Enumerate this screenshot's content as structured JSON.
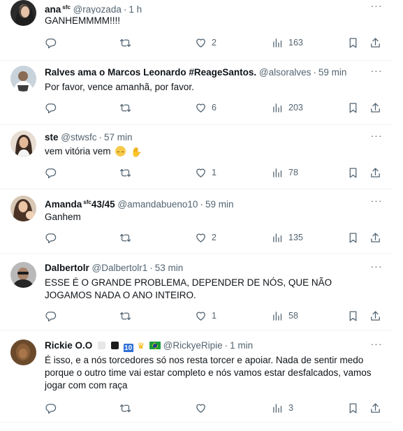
{
  "tweets": [
    {
      "name": "ana",
      "name_badge": "sfc",
      "handle": "@rayozada",
      "time": "1 h",
      "text": "GANHEMMMM!!!!",
      "replies": "",
      "retweets": "",
      "likes": "2",
      "views": "163"
    },
    {
      "name": "Ralves ama o Marcos Leonardo #ReageSantos.",
      "handle": "@alsoralves",
      "time": "59 min",
      "text": "Por favor, vence amanhã, por favor.",
      "replies": "",
      "retweets": "",
      "likes": "6",
      "views": "203"
    },
    {
      "name": "ste",
      "handle": "@stwsfc",
      "time": "57 min",
      "text": "vem vitória vem",
      "replies": "",
      "retweets": "",
      "likes": "1",
      "views": "78"
    },
    {
      "name": "Amanda",
      "name_badge": "sfc",
      "name_suffix": "43/45",
      "handle": "@amandabueno10",
      "time": "59 min",
      "text": "Ganhem",
      "replies": "",
      "retweets": "",
      "likes": "2",
      "views": "135"
    },
    {
      "name": "Dalbertolr",
      "handle": "@Dalbertolr1",
      "time": "53 min",
      "text": "ESSE É  O GRANDE PROBLEMA, DEPENDER DE NÓS, QUE NÃO JOGAMOS NADA O ANO INTEIRO.",
      "replies": "",
      "retweets": "",
      "likes": "1",
      "views": "58"
    },
    {
      "name": "Rickie O.O",
      "name_tag": "10",
      "handle": "@RickyeRipie",
      "time": "1 min",
      "text": "É isso, e a nós torcedores só nos resta torcer e apoiar. Nada de sentir medo porque o outro time vai estar completo e nós vamos estar desfalcados, vamos jogar com com raça",
      "replies": "",
      "retweets": "",
      "likes": "",
      "views": "3"
    }
  ],
  "ui": {
    "separator": "·",
    "more": "···"
  },
  "colors": {
    "text": "#0f1419",
    "muted": "#536471",
    "divider": "#eff3f4"
  },
  "icons": [
    "reply-icon",
    "retweet-icon",
    "like-icon",
    "views-icon",
    "bookmark-icon",
    "share-icon",
    "more-icon"
  ]
}
